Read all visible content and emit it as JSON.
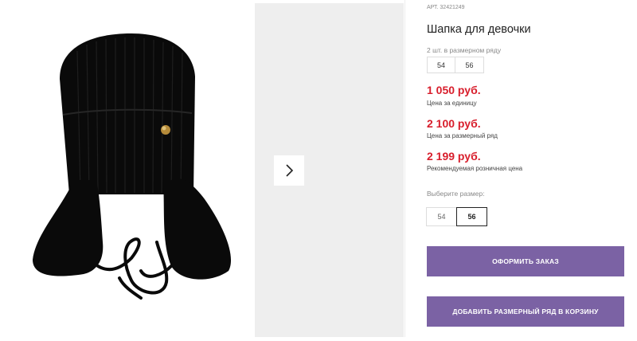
{
  "product": {
    "article": "АРТ. 32421249",
    "title": "Шапка для девочки",
    "series_caption": "2 шт. в размерном ряду",
    "series_sizes": [
      "54",
      "56"
    ],
    "image_icon": "knit-hat-with-ear-flaps-black"
  },
  "prices": [
    {
      "value": "1 050 руб.",
      "caption": "Цена за единицу"
    },
    {
      "value": "2 100 руб.",
      "caption": "Цена за размерный ряд"
    },
    {
      "value": "2 199 руб.",
      "caption": "Рекомендуемая розничная цена"
    }
  ],
  "size_selector": {
    "caption": "Выберите размер:",
    "options": [
      "54",
      "56"
    ],
    "selected": "56"
  },
  "buttons": {
    "order": "ОФОРМИТЬ ЗАКАЗ",
    "add_series": "ДОБАВИТЬ РАЗМЕРНЫЙ РЯД В КОРЗИНУ"
  },
  "gallery": {
    "next_icon": "chevron-right-icon"
  },
  "colors": {
    "price": "#d81e2c",
    "button": "#7b62a4",
    "hat": "#0a0a0a"
  }
}
